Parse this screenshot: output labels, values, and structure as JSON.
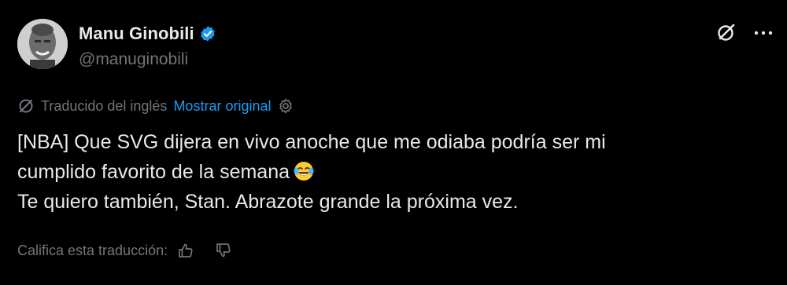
{
  "author": {
    "name": "Manu Ginobili",
    "handle": "@manuginobili",
    "verified_color": "#1d9bf0",
    "avatar_icon": "profile-photo"
  },
  "actions": {
    "grok_icon": "grok-icon",
    "more_icon": "more-icon"
  },
  "translation": {
    "translated_from": "Traducido del inglés",
    "show_original": "Mostrar original",
    "link_color": "#1d9bf0"
  },
  "tweet": {
    "lines": [
      "[NBA] Que SVG dijera en vivo anoche que me odiaba podría ser mi",
      "cumplido favorito de la semana",
      "Te quiero también, Stan. Abrazote grande la próxima vez."
    ],
    "emoji": "😂"
  },
  "rating": {
    "label": "Califica esta traducción:"
  },
  "colors": {
    "background": "#000000",
    "text_primary": "#e7e9ea",
    "text_secondary": "#71767b"
  }
}
